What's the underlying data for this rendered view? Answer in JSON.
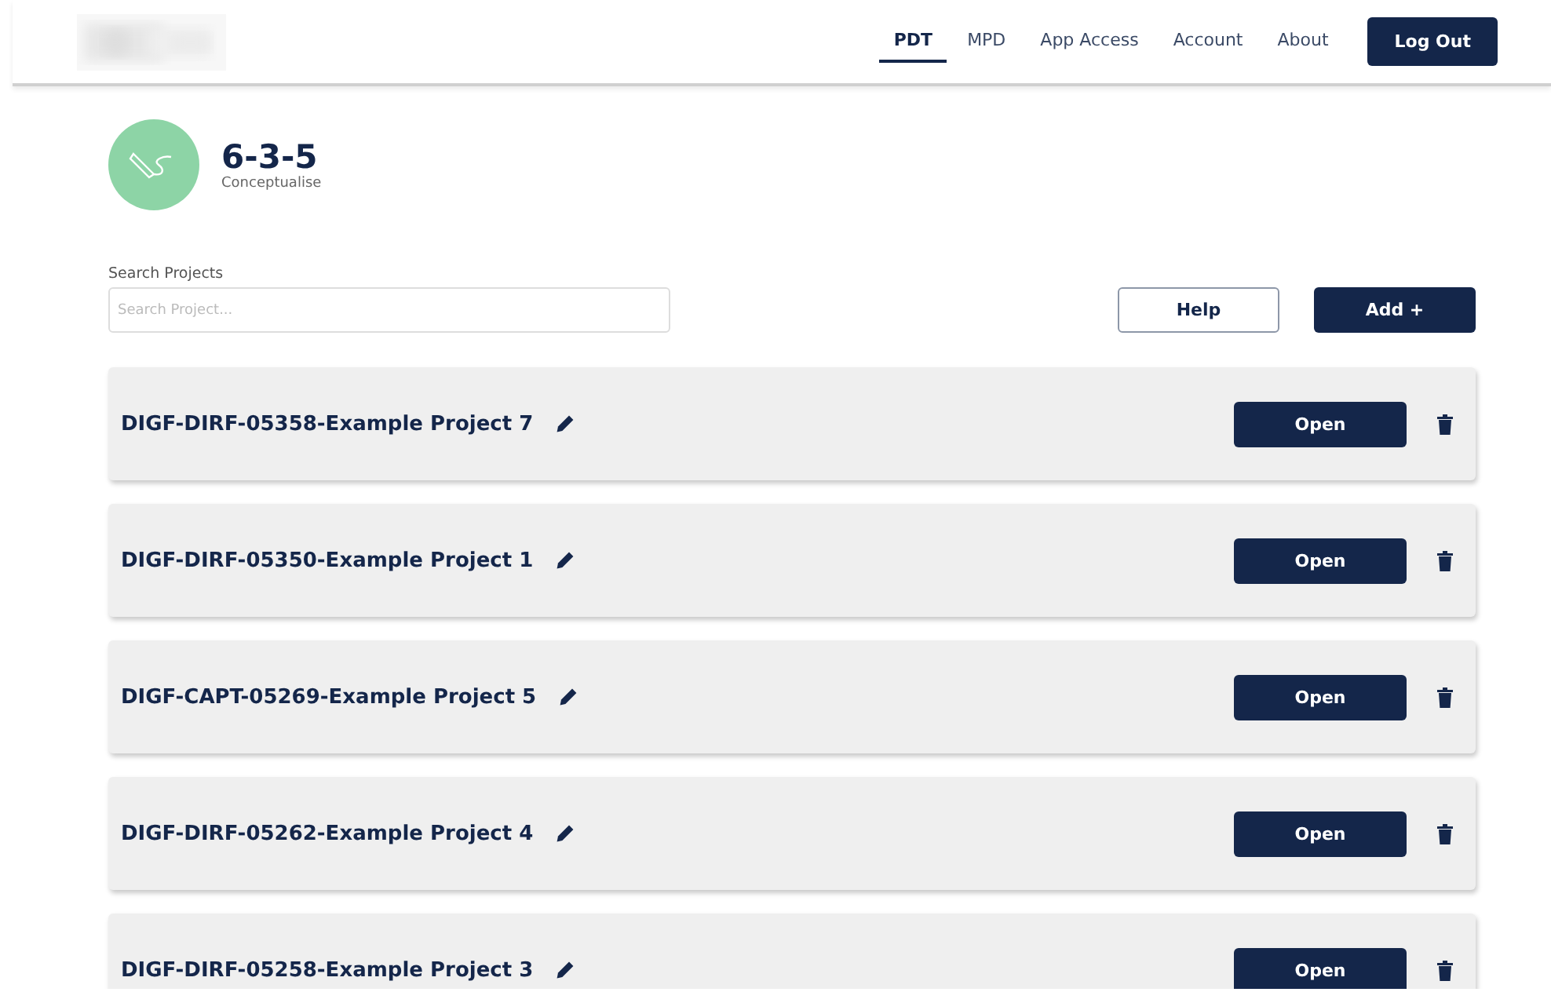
{
  "nav": {
    "tabs": [
      {
        "label": "PDT",
        "selected": true
      },
      {
        "label": "MPD",
        "selected": false
      },
      {
        "label": "App Access",
        "selected": false
      },
      {
        "label": "Account",
        "selected": false
      },
      {
        "label": "About",
        "selected": false
      }
    ],
    "logout": "Log Out"
  },
  "tool": {
    "title": "6-3-5",
    "subtitle": "Conceptualise"
  },
  "search": {
    "label": "Search Projects",
    "placeholder": "Search Project..."
  },
  "buttons": {
    "help": "Help",
    "add": "Add +"
  },
  "projects": [
    {
      "name": "DIGF-DIRF-05358-Example Project 7",
      "action": "Open"
    },
    {
      "name": "DIGF-DIRF-05350-Example Project 1",
      "action": "Open"
    },
    {
      "name": "DIGF-CAPT-05269-Example Project 5",
      "action": "Open"
    },
    {
      "name": "DIGF-DIRF-05262-Example Project 4",
      "action": "Open"
    },
    {
      "name": "DIGF-DIRF-05258-Example Project 3",
      "action": "Open"
    }
  ]
}
